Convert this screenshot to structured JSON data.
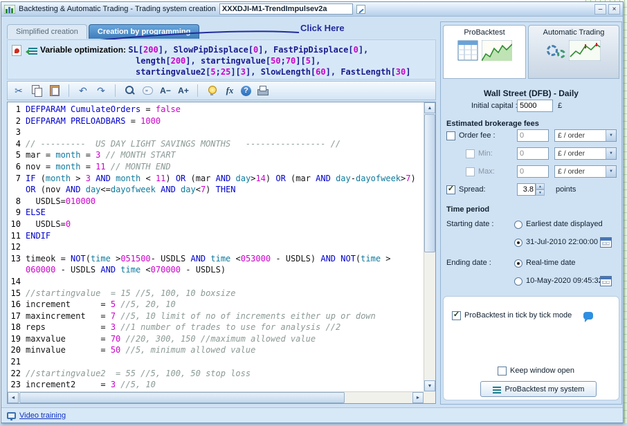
{
  "window": {
    "title": "Backtesting & Automatic Trading - Trading system creation",
    "system_name": "XXXDJI-M1-TrendImpulsev2a"
  },
  "glyphs": {
    "minimize": "–",
    "close": "×",
    "cut": "✂",
    "undo": "↶",
    "redo": "↷",
    "font_smaller": "A−",
    "font_larger": "A+",
    "fx": "fx",
    "help": "?",
    "up": "▲",
    "down": "▼",
    "left": "◄",
    "right": "►",
    "check": "✓",
    "dropdown": "▼"
  },
  "tabs": {
    "simplified": "Simplified creation",
    "programming": "Creation by programming"
  },
  "annotation": {
    "click_here": "Click Here"
  },
  "optimization": {
    "label": "Variable optimization:",
    "line1": [
      [
        "SL",
        "i"
      ],
      [
        "[",
        "p"
      ],
      [
        "200",
        "n"
      ],
      [
        "], ",
        "p"
      ],
      [
        "SlowPipDisplace",
        "i"
      ],
      [
        "[",
        "p"
      ],
      [
        "0",
        "n"
      ],
      [
        "], ",
        "p"
      ],
      [
        "FastPipDisplace",
        "i"
      ],
      [
        "[",
        "p"
      ],
      [
        "0",
        "n"
      ],
      [
        "],",
        "p"
      ]
    ],
    "line2": [
      [
        "length",
        "i"
      ],
      [
        "[",
        "p"
      ],
      [
        "200",
        "n"
      ],
      [
        "], ",
        "p"
      ],
      [
        "startingvalue",
        "i"
      ],
      [
        "[",
        "p"
      ],
      [
        "50",
        "n"
      ],
      [
        ";",
        "p"
      ],
      [
        "70",
        "n"
      ],
      [
        "][",
        "p"
      ],
      [
        "5",
        "n"
      ],
      [
        "],",
        "p"
      ]
    ],
    "line3": [
      [
        "startingvalue2",
        "i"
      ],
      [
        "[",
        "p"
      ],
      [
        "5",
        "n"
      ],
      [
        ";",
        "p"
      ],
      [
        "25",
        "n"
      ],
      [
        "][",
        "p"
      ],
      [
        "3",
        "n"
      ],
      [
        "], ",
        "p"
      ],
      [
        "SlowLength",
        "i"
      ],
      [
        "[",
        "p"
      ],
      [
        "60",
        "n"
      ],
      [
        "], ",
        "p"
      ],
      [
        "FastLength",
        "i"
      ],
      [
        "[",
        "p"
      ],
      [
        "30",
        "n"
      ],
      [
        "]",
        "p"
      ]
    ]
  },
  "editor": {
    "lines": [
      {
        "n": "1",
        "s": [
          [
            "DEFPARAM CumulateOrders ",
            "k"
          ],
          [
            "= ",
            "p"
          ],
          [
            "false",
            "n"
          ]
        ]
      },
      {
        "n": "2",
        "s": [
          [
            "DEFPARAM PRELOADBARS ",
            "k"
          ],
          [
            "= ",
            "p"
          ],
          [
            "1000",
            "n"
          ]
        ]
      },
      {
        "n": "3",
        "s": []
      },
      {
        "n": "4",
        "s": [
          [
            "// ---------  US DAY LIGHT SAVINGS MONTHS   ---------------- //",
            "c"
          ]
        ]
      },
      {
        "n": "5",
        "s": [
          [
            "mar = ",
            "p"
          ],
          [
            "month",
            "f"
          ],
          [
            " = ",
            "p"
          ],
          [
            "3",
            "n"
          ],
          [
            " // MONTH START",
            "c"
          ]
        ]
      },
      {
        "n": "6",
        "s": [
          [
            "nov = ",
            "p"
          ],
          [
            "month",
            "f"
          ],
          [
            " = ",
            "p"
          ],
          [
            "11",
            "n"
          ],
          [
            " // MONTH END",
            "c"
          ]
        ]
      },
      {
        "n": "7",
        "s": [
          [
            "IF ",
            "k"
          ],
          [
            "(",
            "p"
          ],
          [
            "month",
            "f"
          ],
          [
            " > ",
            "p"
          ],
          [
            "3",
            "n"
          ],
          [
            " AND ",
            "k"
          ],
          [
            "month",
            "f"
          ],
          [
            " < ",
            "p"
          ],
          [
            "11",
            "n"
          ],
          [
            ") ",
            "p"
          ],
          [
            "OR ",
            "k"
          ],
          [
            "(mar ",
            "p"
          ],
          [
            "AND ",
            "k"
          ],
          [
            "day",
            "f"
          ],
          [
            ">",
            "p"
          ],
          [
            "14",
            "n"
          ],
          [
            ") ",
            "p"
          ],
          [
            "OR ",
            "k"
          ],
          [
            "(mar ",
            "p"
          ],
          [
            "AND ",
            "k"
          ],
          [
            "day",
            "f"
          ],
          [
            "-",
            "p"
          ],
          [
            "dayofweek",
            "f"
          ],
          [
            ">",
            "p"
          ],
          [
            "7",
            "n"
          ],
          [
            ") ",
            "p"
          ],
          [
            "OR ",
            "k"
          ],
          [
            "(nov ",
            "p"
          ],
          [
            "AND ",
            "k"
          ],
          [
            "day",
            "f"
          ],
          [
            "<=",
            "p"
          ],
          [
            "dayofweek",
            "f"
          ],
          [
            " AND ",
            "k"
          ],
          [
            "day",
            "f"
          ],
          [
            "<",
            "p"
          ],
          [
            "7",
            "n"
          ],
          [
            ") ",
            "p"
          ],
          [
            "THEN",
            "k"
          ]
        ]
      },
      {
        "n": "8",
        "s": [
          [
            "  USDLS=",
            "p"
          ],
          [
            "010000",
            "n"
          ]
        ]
      },
      {
        "n": "9",
        "s": [
          [
            "ELSE",
            "k"
          ]
        ]
      },
      {
        "n": "10",
        "s": [
          [
            "  USDLS=",
            "p"
          ],
          [
            "0",
            "n"
          ]
        ]
      },
      {
        "n": "11",
        "s": [
          [
            "ENDIF",
            "k"
          ]
        ]
      },
      {
        "n": "12",
        "s": []
      },
      {
        "n": "13",
        "s": [
          [
            "timeok = ",
            "p"
          ],
          [
            "NOT",
            "k"
          ],
          [
            "(",
            "p"
          ],
          [
            "time",
            "f"
          ],
          [
            " >",
            "p"
          ],
          [
            "051500",
            "n"
          ],
          [
            "- USDLS ",
            "p"
          ],
          [
            "AND ",
            "k"
          ],
          [
            "time",
            "f"
          ],
          [
            " <",
            "p"
          ],
          [
            "053000",
            "n"
          ],
          [
            " - USDLS) ",
            "p"
          ],
          [
            "AND NOT",
            "k"
          ],
          [
            "(",
            "p"
          ],
          [
            "time",
            "f"
          ],
          [
            " > ",
            "p"
          ],
          [
            "060000",
            "n"
          ],
          [
            " - USDLS ",
            "p"
          ],
          [
            "AND ",
            "k"
          ],
          [
            "time",
            "f"
          ],
          [
            " <",
            "p"
          ],
          [
            "070000",
            "n"
          ],
          [
            " - USDLS)",
            "p"
          ]
        ]
      },
      {
        "n": "14",
        "s": []
      },
      {
        "n": "15",
        "s": [
          [
            "//startingvalue  = 15 //5, 100, 10 boxsize",
            "c"
          ]
        ]
      },
      {
        "n": "16",
        "s": [
          [
            "increment      = ",
            "p"
          ],
          [
            "5",
            "n"
          ],
          [
            " //5, 20, 10",
            "c"
          ]
        ]
      },
      {
        "n": "17",
        "s": [
          [
            "maxincrement   = ",
            "p"
          ],
          [
            "7",
            "n"
          ],
          [
            " //5, 10 limit of no of increments either up or down",
            "c"
          ]
        ]
      },
      {
        "n": "18",
        "s": [
          [
            "reps           = ",
            "p"
          ],
          [
            "3",
            "n"
          ],
          [
            " //1 number of trades to use for analysis //2",
            "c"
          ]
        ]
      },
      {
        "n": "19",
        "s": [
          [
            "maxvalue       = ",
            "p"
          ],
          [
            "70",
            "n"
          ],
          [
            " //20, 300, 150 //maximum allowed value",
            "c"
          ]
        ]
      },
      {
        "n": "20",
        "s": [
          [
            "minvalue       = ",
            "p"
          ],
          [
            "50",
            "n"
          ],
          [
            " //5, minimum allowed value",
            "c"
          ]
        ]
      },
      {
        "n": "21",
        "s": []
      },
      {
        "n": "22",
        "s": [
          [
            "//startingvalue2  = 55 //5, 100, 50 stop loss",
            "c"
          ]
        ]
      },
      {
        "n": "23",
        "s": [
          [
            "increment2     = ",
            "p"
          ],
          [
            "3",
            "n"
          ],
          [
            " //5, 10",
            "c"
          ]
        ]
      }
    ]
  },
  "right": {
    "tab_probacktest": "ProBacktest",
    "tab_auto": "Automatic Trading",
    "instrument": "Wall Street (DFB) - Daily",
    "initial_capital_label": "Initial capital :",
    "initial_capital_value": "5000",
    "currency": "£",
    "fees_title": "Estimated brokerage fees",
    "order_fee_label": "Order fee :",
    "order_fee_value": "0",
    "min_label": "Min:",
    "min_value": "0",
    "max_label": "Max:",
    "max_value": "0",
    "fee_unit": "£ / order",
    "spread_label": "Spread:",
    "spread_value": "3.8",
    "spread_unit": "points",
    "time_period_title": "Time period",
    "starting_date_label": "Starting date :",
    "earliest_option": "Earliest date displayed",
    "start_date_value": "31-Jul-2010 22:00:00",
    "ending_date_label": "Ending date :",
    "realtime_option": "Real-time date",
    "end_date_value": "10-May-2020 09:45:32",
    "tick_mode_label": "ProBacktest in tick by tick mode",
    "keep_open_label": "Keep window open",
    "run_button_label": "ProBacktest my system"
  },
  "statusbar": {
    "video_training": "Video training"
  }
}
